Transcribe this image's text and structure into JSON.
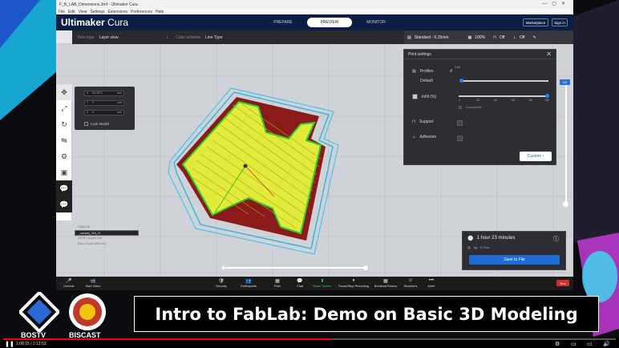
{
  "window": {
    "title": "F_B_LAB_Dimensions.3mf - Ultimaker Cura",
    "menu": [
      "File",
      "Edit",
      "View",
      "Settings",
      "Extensions",
      "Preferences",
      "Help"
    ]
  },
  "header": {
    "brand_main": "Ultimaker",
    "brand_sub": "Cura",
    "stages": [
      "PREPARE",
      "PREVIEW",
      "MONITOR"
    ],
    "active_stage": "PREVIEW",
    "marketplace_label": "Marketplace",
    "signin_label": "Sign in"
  },
  "toolbar": {
    "view_type_label": "View type",
    "view_type_value": "Layer view",
    "color_scheme_label": "Color scheme",
    "color_scheme_value": "Line Type",
    "profile": "Standard - 0.15mm",
    "infill": "100%",
    "support": "Off",
    "adhesion": "Off"
  },
  "move_panel": {
    "x_label": "X",
    "x_value": "53.2971",
    "y_label": "Y",
    "y_value": "0",
    "z_label": "Z",
    "z_value": "0",
    "unit": "mm",
    "lock_label": "Lock Model"
  },
  "print_settings": {
    "title": "Print settings",
    "profiles_label": "Profiles",
    "profile_default": "Default",
    "layer_height": "0.15",
    "infill_label": "Infill (%)",
    "infill_ticks": [
      "0",
      "20",
      "40",
      "60",
      "80",
      "100"
    ],
    "gradual_label": "Gradual infill",
    "support_label": "Support",
    "adhesion_label": "Adhesion",
    "custom_label": "Custom"
  },
  "layer_slider": {
    "value": "113"
  },
  "objects": {
    "header": "Object list",
    "items": [
      "_samplej_3mf_21",
      "UMS5_sample.3mf",
      "Basic Shape (8x8 mm)"
    ]
  },
  "estimate": {
    "time": "1 hour 23 minutes",
    "weight": "8g · 0.71m",
    "save_label": "Save to File"
  },
  "zoom": {
    "items": [
      "Unmute",
      "Start Video",
      "Security",
      "Participants",
      "Polls",
      "Chat",
      "Share Screen",
      "Pause/Stop Recording",
      "Breakout Rooms",
      "Reactions",
      "More"
    ],
    "end_label": "End"
  },
  "overlay": {
    "title": "Intro to FabLab: Demo on Basic 3D Modeling",
    "logo_left": "BOSTV",
    "logo_right": "BISCAST"
  },
  "player": {
    "timecode": "1:08:15 / 2:13:53"
  }
}
